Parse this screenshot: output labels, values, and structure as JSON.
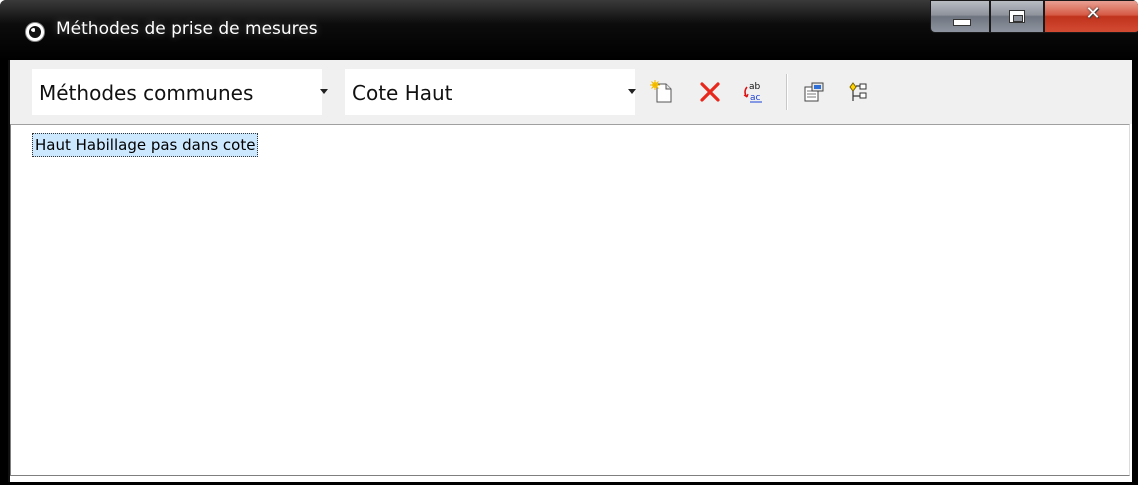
{
  "window": {
    "title": "Méthodes de prise de mesures"
  },
  "toolbar": {
    "category_combo": {
      "value": "Méthodes communes"
    },
    "method_combo": {
      "value": "Cote Haut"
    },
    "icons": [
      "new-document-icon",
      "delete-icon",
      "rename-icon",
      "properties-icon",
      "sort-icon"
    ]
  },
  "list": {
    "items": [
      {
        "label": "Haut Habillage pas dans cote",
        "selected": true
      }
    ]
  },
  "colors": {
    "selection": "#cce8ff",
    "close_button": "#c0321c",
    "delete_icon": "#e8281c"
  }
}
